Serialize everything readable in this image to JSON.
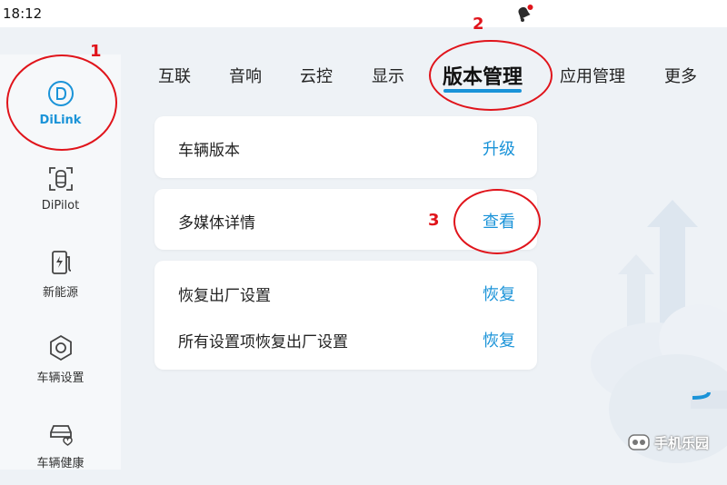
{
  "status_bar": {
    "time": "18:12",
    "notification_color": "#e0141b"
  },
  "sidebar": {
    "items": [
      {
        "label": "DiLink",
        "icon": "dilink-icon",
        "active": true
      },
      {
        "label": "DiPilot",
        "icon": "car-sensor-icon"
      },
      {
        "label": "新能源",
        "icon": "charger-icon"
      },
      {
        "label": "车辆设置",
        "icon": "hexagon-gear-icon"
      },
      {
        "label": "车辆健康",
        "icon": "car-heart-icon"
      }
    ]
  },
  "tabs": {
    "items": [
      "互联",
      "音响",
      "云控",
      "显示",
      "版本管理",
      "应用管理",
      "更多"
    ],
    "active_index": 4
  },
  "cards": {
    "vehicle_version": {
      "label": "车辆版本",
      "action": "升级"
    },
    "multimedia": {
      "label": "多媒体详情",
      "action": "查看"
    },
    "factory_reset": {
      "label": "恢复出厂设置",
      "action": "恢复"
    },
    "all_reset": {
      "label": "所有设置项恢复出厂设置",
      "action": "恢复"
    }
  },
  "annotations": {
    "one": "1",
    "two": "2",
    "three": "3",
    "color": "#e0141b"
  },
  "watermark": {
    "text": "手机乐园"
  },
  "accent_color": "#1a93d8"
}
